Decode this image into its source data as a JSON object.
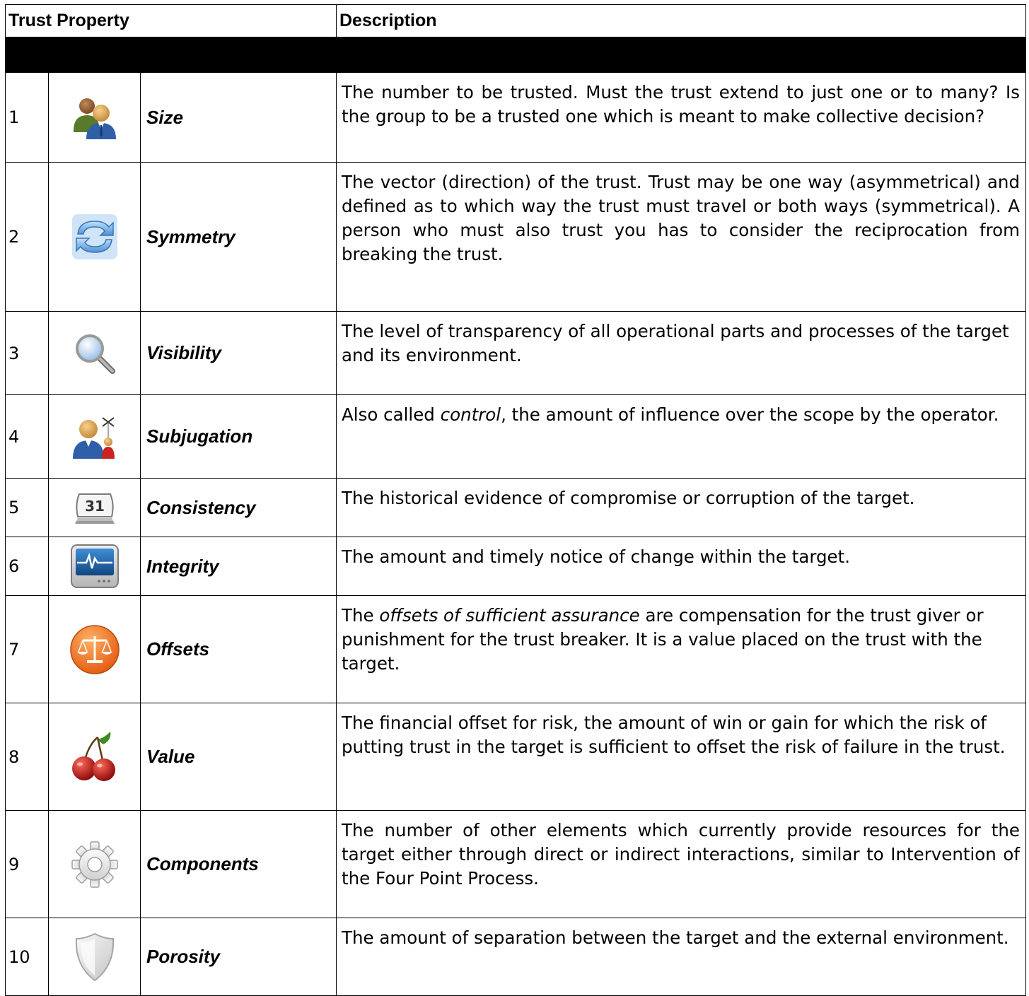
{
  "header": {
    "col_property": "Trust Property",
    "col_description": "Description"
  },
  "rows": [
    {
      "num": "1",
      "icon": "users-icon",
      "property": "Size",
      "desc_a": "The number to be trusted. Must the trust extend to just one or to many? Is the group to be a trusted one which is meant to make collective decision?",
      "desc_em": "",
      "desc_b": ""
    },
    {
      "num": "2",
      "icon": "refresh-arrows-icon",
      "property": "Symmetry",
      "desc_a": "The vector (direction) of the trust. Trust may be one way (asymmetrical) and defined as to which way the trust must travel or both ways (symmetrical). A person who must also trust you has to consider the reciprocation from breaking the trust.",
      "desc_em": "",
      "desc_b": ""
    },
    {
      "num": "3",
      "icon": "magnifier-icon",
      "property": "Visibility",
      "desc_a": "The level of transparency of all operational parts and processes of the target and its environment.",
      "desc_em": "",
      "desc_b": ""
    },
    {
      "num": "4",
      "icon": "puppet-master-icon",
      "property": "Subjugation",
      "desc_a": "Also called ",
      "desc_em": "control",
      "desc_b": ", the amount of influence over the scope by the operator."
    },
    {
      "num": "5",
      "icon": "calendar-icon",
      "calendar_day": "31",
      "property": "Consistency",
      "desc_a": "The historical evidence of compromise or corruption of the target.",
      "desc_em": "",
      "desc_b": ""
    },
    {
      "num": "6",
      "icon": "heart-monitor-icon",
      "property": "Integrity",
      "desc_a": "The amount and timely notice of change within the target.",
      "desc_em": "",
      "desc_b": ""
    },
    {
      "num": "7",
      "icon": "scales-icon",
      "property": "Offsets",
      "desc_a": "The ",
      "desc_em": "offsets of sufficient assurance",
      "desc_b": " are compensation for the trust giver or punishment for the trust breaker. It is a value placed on the trust with the target."
    },
    {
      "num": "8",
      "icon": "cherries-icon",
      "property": "Value",
      "desc_a": "The financial offset for risk, the amount of win or gain for which the risk of putting trust in the target is sufficient to offset the risk of failure in the trust.",
      "desc_em": "",
      "desc_b": ""
    },
    {
      "num": "9",
      "icon": "gear-icon",
      "property": "Components",
      "desc_a": "The number of other elements which currently provide resources for the target either through direct or indirect interactions, similar to Intervention of the Four Point Process.",
      "desc_em": "",
      "desc_b": ""
    },
    {
      "num": "10",
      "icon": "shield-icon",
      "property": "Porosity",
      "desc_a": "The amount of separation between the target and the external environment.",
      "desc_em": "",
      "desc_b": ""
    }
  ]
}
